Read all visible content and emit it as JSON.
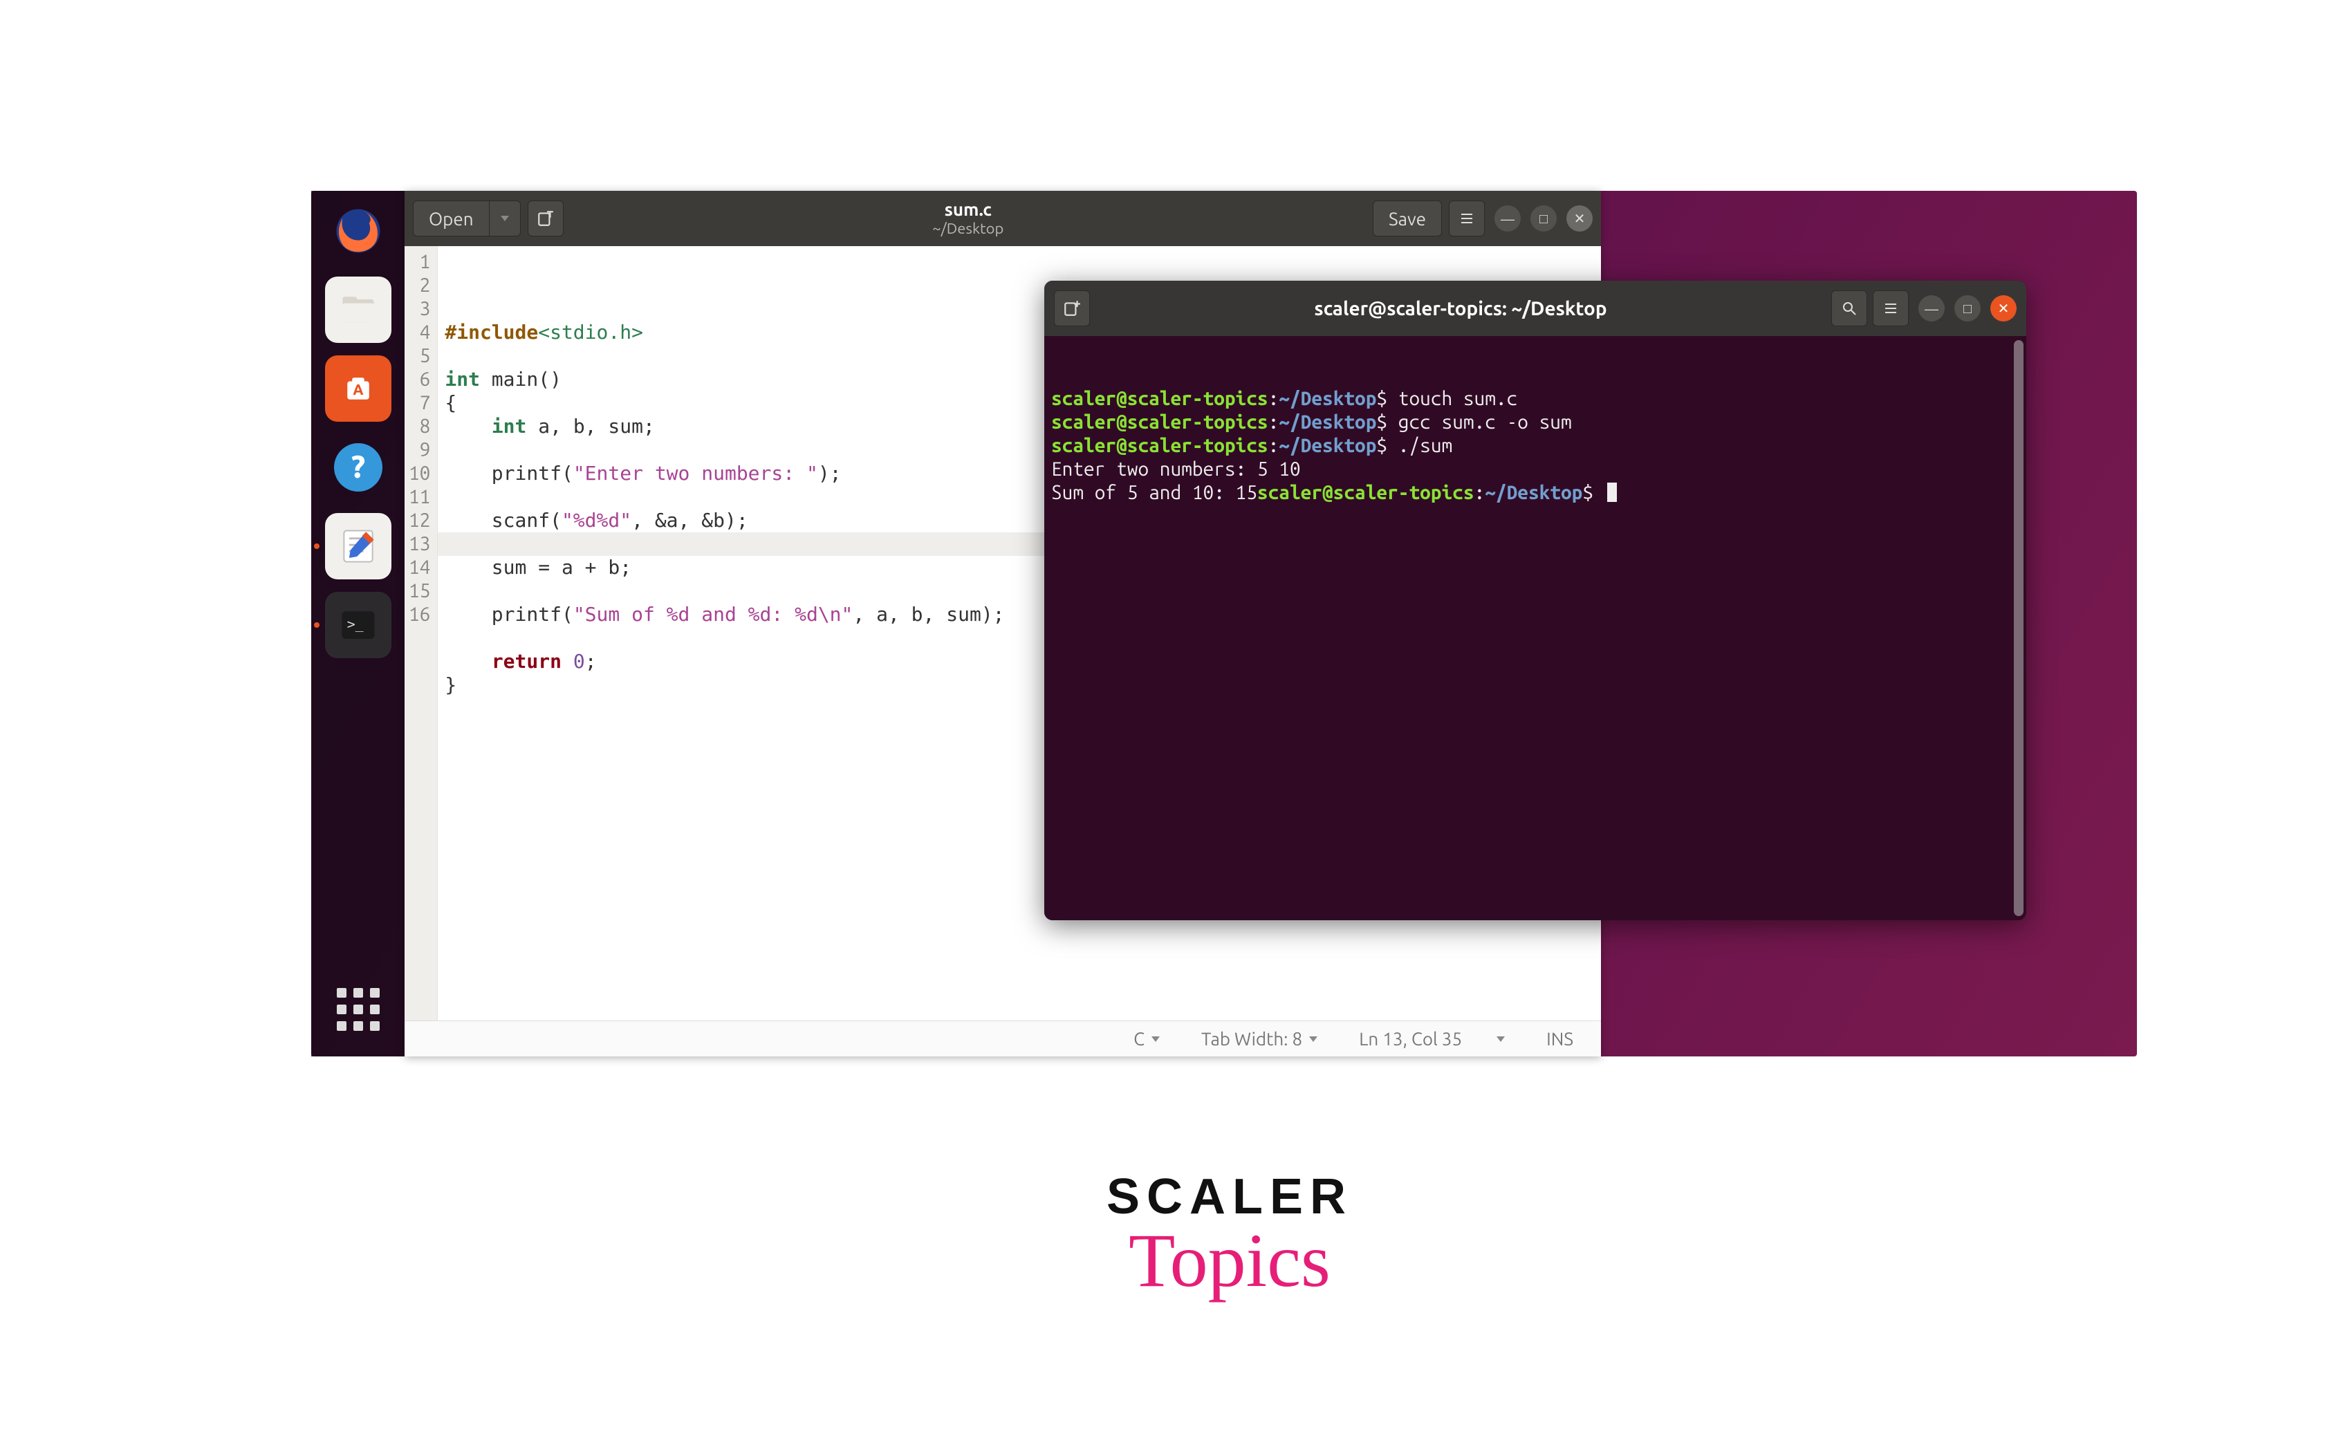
{
  "dock": {
    "items": [
      {
        "name": "firefox-icon"
      },
      {
        "name": "files-icon"
      },
      {
        "name": "software-center-icon"
      },
      {
        "name": "help-icon"
      },
      {
        "name": "text-editor-icon"
      },
      {
        "name": "terminal-icon"
      }
    ]
  },
  "gedit": {
    "open_label": "Open",
    "save_label": "Save",
    "title_filename": "sum.c",
    "title_path": "~/Desktop",
    "code": {
      "line_count": 16,
      "highlighted_line": 13,
      "lines": [
        {
          "n": 1,
          "segments": [
            [
              "pp",
              "#include"
            ],
            [
              "inc",
              "<stdio.h>"
            ]
          ]
        },
        {
          "n": 2,
          "segments": []
        },
        {
          "n": 3,
          "segments": [
            [
              "type",
              "int"
            ],
            [
              "t",
              " main()"
            ]
          ]
        },
        {
          "n": 4,
          "segments": [
            [
              "t",
              "{"
            ]
          ]
        },
        {
          "n": 5,
          "segments": [
            [
              "t",
              "    "
            ],
            [
              "type",
              "int"
            ],
            [
              "t",
              " a, b, sum;"
            ]
          ]
        },
        {
          "n": 6,
          "segments": []
        },
        {
          "n": 7,
          "segments": [
            [
              "t",
              "    printf("
            ],
            [
              "str",
              "\"Enter two numbers: \""
            ],
            [
              "t",
              ");"
            ]
          ]
        },
        {
          "n": 8,
          "segments": []
        },
        {
          "n": 9,
          "segments": [
            [
              "t",
              "    scanf("
            ],
            [
              "str",
              "\"%d%d\""
            ],
            [
              "t",
              ", &a, &b);"
            ]
          ]
        },
        {
          "n": 10,
          "segments": []
        },
        {
          "n": 11,
          "segments": [
            [
              "t",
              "    sum = a + b;"
            ]
          ]
        },
        {
          "n": 12,
          "segments": []
        },
        {
          "n": 13,
          "segments": [
            [
              "t",
              "    printf("
            ],
            [
              "str",
              "\"Sum of %d and %d: %d\\n\""
            ],
            [
              "t",
              ", a, b, sum);"
            ]
          ]
        },
        {
          "n": 14,
          "segments": []
        },
        {
          "n": 15,
          "segments": [
            [
              "t",
              "    "
            ],
            [
              "kw",
              "return"
            ],
            [
              "t",
              " "
            ],
            [
              "num",
              "0"
            ],
            [
              "t",
              ";"
            ]
          ]
        },
        {
          "n": 16,
          "segments": [
            [
              "t",
              "}"
            ]
          ]
        }
      ]
    },
    "statusbar": {
      "language": "C",
      "tab_width": "Tab Width: 8",
      "position": "Ln 13, Col 35",
      "mode": "INS"
    }
  },
  "terminal": {
    "title": "scaler@scaler-topics: ~/Desktop",
    "prompt_user": "scaler@scaler-topics",
    "prompt_path": "~/Desktop",
    "lines": [
      {
        "type": "prompt",
        "cmd": "touch sum.c"
      },
      {
        "type": "prompt",
        "cmd": "gcc sum.c -o sum"
      },
      {
        "type": "prompt",
        "cmd": "./sum"
      },
      {
        "type": "out",
        "text": "Enter two numbers: 5 10"
      },
      {
        "type": "out_inline_prompt",
        "text": "Sum of 5 and 10: 15",
        "cursor": true
      }
    ]
  },
  "logo": {
    "word1": "SCALER",
    "word2": "Topics"
  }
}
